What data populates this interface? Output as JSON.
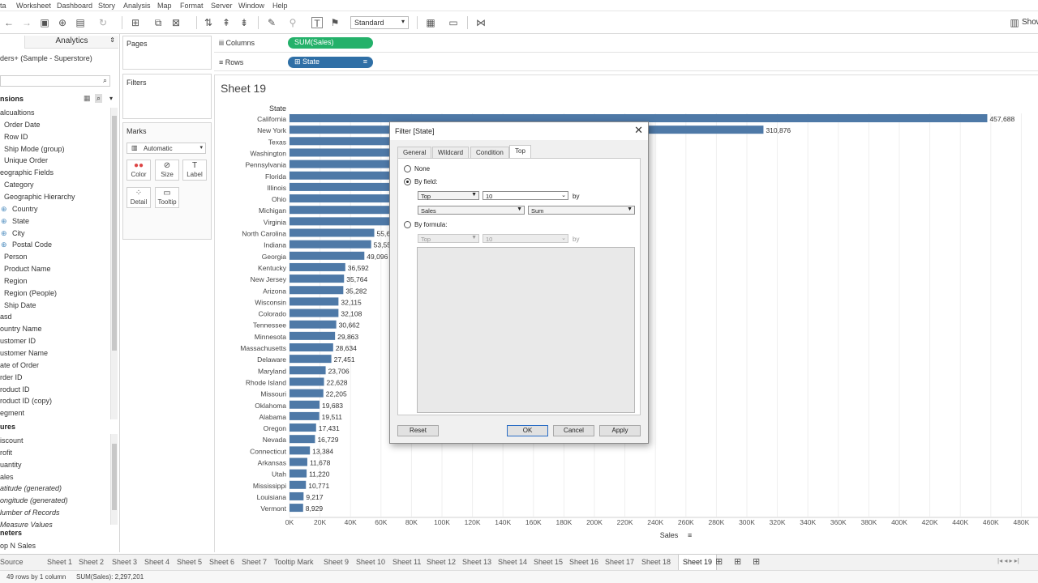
{
  "menubar": {
    "items": [
      "ta",
      "Worksheet",
      "Dashboard",
      "Story",
      "Analysis",
      "Map",
      "Format",
      "Server",
      "Window",
      "Help"
    ],
    "show_me": "Show"
  },
  "toolbar": {
    "view_mode": "Standard"
  },
  "datapane": {
    "analytics_tab": "Analytics",
    "datasource": "ders+ (Sample - Superstore)",
    "dimensions_header": "nsions",
    "dimensions": [
      {
        "label": "alcualtions",
        "indent": 0
      },
      {
        "label": "Order Date",
        "indent": 1
      },
      {
        "label": "Row ID",
        "indent": 1
      },
      {
        "label": "Ship Mode (group)",
        "indent": 1
      },
      {
        "label": "Unique Order",
        "indent": 1
      },
      {
        "label": "eographic Fields",
        "indent": 0
      },
      {
        "label": "Category",
        "indent": 1
      },
      {
        "label": "Geographic Hierarchy",
        "indent": 1
      },
      {
        "label": "Country",
        "indent": 2,
        "geo": true
      },
      {
        "label": "State",
        "indent": 2,
        "geo": true
      },
      {
        "label": "City",
        "indent": 2,
        "geo": true
      },
      {
        "label": "Postal Code",
        "indent": 2,
        "geo": true
      },
      {
        "label": "Person",
        "indent": 1
      },
      {
        "label": "Product Name",
        "indent": 1
      },
      {
        "label": "Region",
        "indent": 1
      },
      {
        "label": "Region (People)",
        "indent": 1
      },
      {
        "label": "Ship Date",
        "indent": 1
      },
      {
        "label": "asd",
        "indent": 0
      },
      {
        "label": "ountry Name",
        "indent": 0
      },
      {
        "label": "ustomer ID",
        "indent": 0
      },
      {
        "label": "ustomer Name",
        "indent": 0
      },
      {
        "label": "ate of Order",
        "indent": 0
      },
      {
        "label": "rder ID",
        "indent": 0
      },
      {
        "label": "roduct ID",
        "indent": 0
      },
      {
        "label": "roduct ID (copy)",
        "indent": 0
      },
      {
        "label": "egment",
        "indent": 0
      }
    ],
    "measures_header": "ures",
    "measures": [
      {
        "label": "iscount",
        "italic": false
      },
      {
        "label": "rofit",
        "italic": false
      },
      {
        "label": "uantity",
        "italic": false
      },
      {
        "label": "ales",
        "italic": false
      },
      {
        "label": "atitude (generated)",
        "italic": true
      },
      {
        "label": "ongitude (generated)",
        "italic": true
      },
      {
        "label": "lumber of Records",
        "italic": true
      },
      {
        "label": "Measure Values",
        "italic": true
      }
    ],
    "parameters_header": "neters",
    "parameters": [
      "op N Sales"
    ]
  },
  "cards": {
    "pages": "Pages",
    "filters": "Filters",
    "marks": "Marks",
    "mark_type": "Automatic",
    "mark_buttons": [
      {
        "label": "Color",
        "icon": "color-icon"
      },
      {
        "label": "Size",
        "icon": "size-icon"
      },
      {
        "label": "Label",
        "icon": "label-icon"
      },
      {
        "label": "Detail",
        "icon": "detail-icon"
      },
      {
        "label": "Tooltip",
        "icon": "tooltip-icon"
      }
    ]
  },
  "shelves": {
    "columns_label": "Columns",
    "rows_label": "Rows",
    "columns_pill": "SUM(Sales)",
    "rows_pill": "State"
  },
  "sheet_title": "Sheet 19",
  "chart_data": {
    "type": "bar",
    "orientation": "horizontal",
    "ylabel": "State",
    "xlabel": "Sales",
    "xlim": [
      0,
      488000
    ],
    "x_ticks": [
      "0K",
      "20K",
      "40K",
      "60K",
      "80K",
      "100K",
      "120K",
      "140K",
      "160K",
      "180K",
      "200K",
      "220K",
      "240K",
      "260K",
      "280K",
      "300K",
      "320K",
      "340K",
      "360K",
      "380K",
      "400K",
      "420K",
      "440K",
      "460K",
      "480K"
    ],
    "bar_color": "#4e79a7",
    "categories": [
      "California",
      "New York",
      "Texas",
      "Washington",
      "Pennsylvania",
      "Florida",
      "Illinois",
      "Ohio",
      "Michigan",
      "Virginia",
      "North Carolina",
      "Indiana",
      "Georgia",
      "Kentucky",
      "New Jersey",
      "Arizona",
      "Wisconsin",
      "Colorado",
      "Tennessee",
      "Minnesota",
      "Massachusetts",
      "Delaware",
      "Maryland",
      "Rhode Island",
      "Missouri",
      "Oklahoma",
      "Alabama",
      "Oregon",
      "Nevada",
      "Connecticut",
      "Arkansas",
      "Utah",
      "Mississippi",
      "Louisiana",
      "Vermont"
    ],
    "values": [
      457688,
      310876,
      170188,
      138641,
      116512,
      89474,
      80166,
      78258,
      76270,
      70637,
      55603,
      53555,
      49096,
      36592,
      35764,
      35282,
      32115,
      32108,
      30662,
      29863,
      28634,
      27451,
      23706,
      22628,
      22205,
      19683,
      19511,
      17431,
      16729,
      13384,
      11678,
      11220,
      10771,
      9217,
      8929
    ],
    "labels": [
      "457,688",
      "310,876",
      "",
      "",
      "",
      "",
      "",
      "",
      "",
      "",
      "55,6",
      "53,55",
      "49,096",
      "36,592",
      "35,764",
      "35,282",
      "32,115",
      "32,108",
      "30,662",
      "29,863",
      "28,634",
      "27,451",
      "23,706",
      "22,628",
      "22,205",
      "19,683",
      "19,511",
      "17,431",
      "16,729",
      "13,384",
      "11,678",
      "11,220",
      "10,771",
      "9,217",
      "8,929"
    ]
  },
  "dialog": {
    "title": "Filter [State]",
    "tabs": [
      "General",
      "Wildcard",
      "Condition",
      "Top"
    ],
    "active_tab": "Top",
    "none_label": "None",
    "by_field_label": "By field:",
    "by_formula_label": "By formula:",
    "top_value": "Top",
    "count_value": "10",
    "by_label": "by",
    "field_value": "Sales",
    "agg_value": "Sum",
    "buttons": {
      "reset": "Reset",
      "ok": "OK",
      "cancel": "Cancel",
      "apply": "Apply"
    }
  },
  "sheet_tabs": [
    "Source",
    "Sheet 1",
    "Sheet 2",
    "Sheet 3",
    "Sheet 4",
    "Sheet 5",
    "Sheet 6",
    "Sheet 7",
    "Tooltip Mark",
    "Sheet 9",
    "Sheet 10",
    "Sheet 11",
    "Sheet 12",
    "Sheet 13",
    "Sheet 14",
    "Sheet 15",
    "Sheet 16",
    "Sheet 17",
    "Sheet 18",
    "Sheet 19"
  ],
  "active_sheet": "Sheet 19",
  "status": {
    "rows_cols": "49 rows by 1 column",
    "sum": "SUM(Sales): 2,297,201"
  }
}
